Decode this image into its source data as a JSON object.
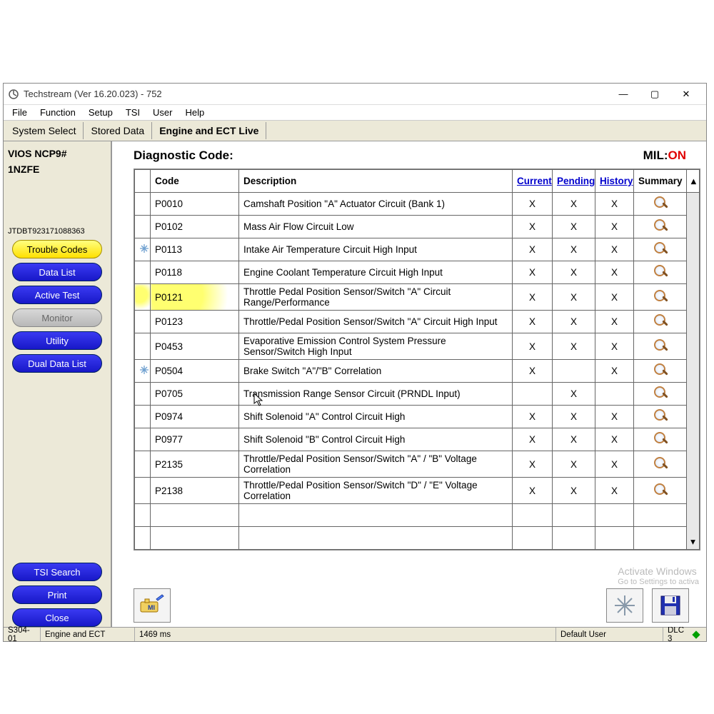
{
  "window": {
    "title": "Techstream (Ver 16.20.023) - 752",
    "controls": {
      "minimize": "—",
      "maximize": "▢",
      "close": "✕"
    }
  },
  "menu": [
    "File",
    "Function",
    "Setup",
    "TSI",
    "User",
    "Help"
  ],
  "tabs": [
    {
      "label": "System Select",
      "active": false
    },
    {
      "label": "Stored Data",
      "active": false
    },
    {
      "label": "Engine and ECT Live",
      "active": true
    }
  ],
  "sidebar": {
    "vehicle_line1": "VIOS NCP9#",
    "vehicle_line2": "1NZFE",
    "vin": "JTDBT923171088363",
    "buttons": [
      {
        "label": "Trouble Codes",
        "style": "yellow"
      },
      {
        "label": "Data List",
        "style": "blue"
      },
      {
        "label": "Active Test",
        "style": "blue"
      },
      {
        "label": "Monitor",
        "style": "gray"
      },
      {
        "label": "Utility",
        "style": "blue"
      },
      {
        "label": "Dual Data List",
        "style": "blue"
      }
    ],
    "bottom_buttons": [
      {
        "label": "TSI Search",
        "style": "blue"
      },
      {
        "label": "Print",
        "style": "blue"
      },
      {
        "label": "Close",
        "style": "blue"
      }
    ]
  },
  "main": {
    "title": "Diagnostic Code:",
    "mil_label": "MIL:",
    "mil_value": "ON",
    "columns": {
      "code": "Code",
      "description": "Description",
      "current": "Current",
      "pending": "Pending",
      "history": "History",
      "summary": "Summary"
    },
    "rows": [
      {
        "freeze": false,
        "code": "P0010",
        "desc": "Camshaft Position \"A\" Actuator Circuit (Bank 1)",
        "cur": "X",
        "pen": "X",
        "his": "X",
        "sum": true,
        "hl": false
      },
      {
        "freeze": false,
        "code": "P0102",
        "desc": "Mass Air Flow Circuit Low",
        "cur": "X",
        "pen": "X",
        "his": "X",
        "sum": true,
        "hl": false
      },
      {
        "freeze": true,
        "code": "P0113",
        "desc": "Intake Air Temperature Circuit High Input",
        "cur": "X",
        "pen": "X",
        "his": "X",
        "sum": true,
        "hl": false
      },
      {
        "freeze": false,
        "code": "P0118",
        "desc": "Engine Coolant Temperature Circuit High Input",
        "cur": "X",
        "pen": "X",
        "his": "X",
        "sum": true,
        "hl": false
      },
      {
        "freeze": false,
        "code": "P0121",
        "desc": "Throttle Pedal Position Sensor/Switch \"A\" Circuit Range/Performance",
        "cur": "X",
        "pen": "X",
        "his": "X",
        "sum": true,
        "hl": true
      },
      {
        "freeze": false,
        "code": "P0123",
        "desc": "Throttle/Pedal Position Sensor/Switch \"A\" Circuit High Input",
        "cur": "X",
        "pen": "X",
        "his": "X",
        "sum": true,
        "hl": false
      },
      {
        "freeze": false,
        "code": "P0453",
        "desc": "Evaporative Emission Control System Pressure Sensor/Switch High Input",
        "cur": "X",
        "pen": "X",
        "his": "X",
        "sum": true,
        "hl": false
      },
      {
        "freeze": true,
        "code": "P0504",
        "desc": "Brake Switch \"A\"/\"B\" Correlation",
        "cur": "X",
        "pen": "",
        "his": "X",
        "sum": true,
        "hl": false
      },
      {
        "freeze": false,
        "code": "P0705",
        "desc": "Transmission Range Sensor Circuit (PRNDL Input)",
        "cur": "",
        "pen": "X",
        "his": "",
        "sum": true,
        "hl": false
      },
      {
        "freeze": false,
        "code": "P0974",
        "desc": "Shift Solenoid \"A\" Control Circuit High",
        "cur": "X",
        "pen": "X",
        "his": "X",
        "sum": true,
        "hl": false
      },
      {
        "freeze": false,
        "code": "P0977",
        "desc": "Shift Solenoid \"B\" Control Circuit High",
        "cur": "X",
        "pen": "X",
        "his": "X",
        "sum": true,
        "hl": false
      },
      {
        "freeze": false,
        "code": "P2135",
        "desc": "Throttle/Pedal Position Sensor/Switch \"A\" / \"B\" Voltage Correlation",
        "cur": "X",
        "pen": "X",
        "his": "X",
        "sum": true,
        "hl": false
      },
      {
        "freeze": false,
        "code": "P2138",
        "desc": "Throttle/Pedal Position Sensor/Switch \"D\" / \"E\" Voltage Correlation",
        "cur": "X",
        "pen": "X",
        "his": "X",
        "sum": true,
        "hl": false
      }
    ],
    "empty_rows": 2
  },
  "status": {
    "cell1": "S304-01",
    "cell2": "Engine and ECT",
    "cell3": "1469 ms",
    "user": "Default User",
    "dlc": "DLC 3"
  },
  "watermark": {
    "line1": "Activate Windows",
    "line2": "Go to Settings to activa"
  }
}
